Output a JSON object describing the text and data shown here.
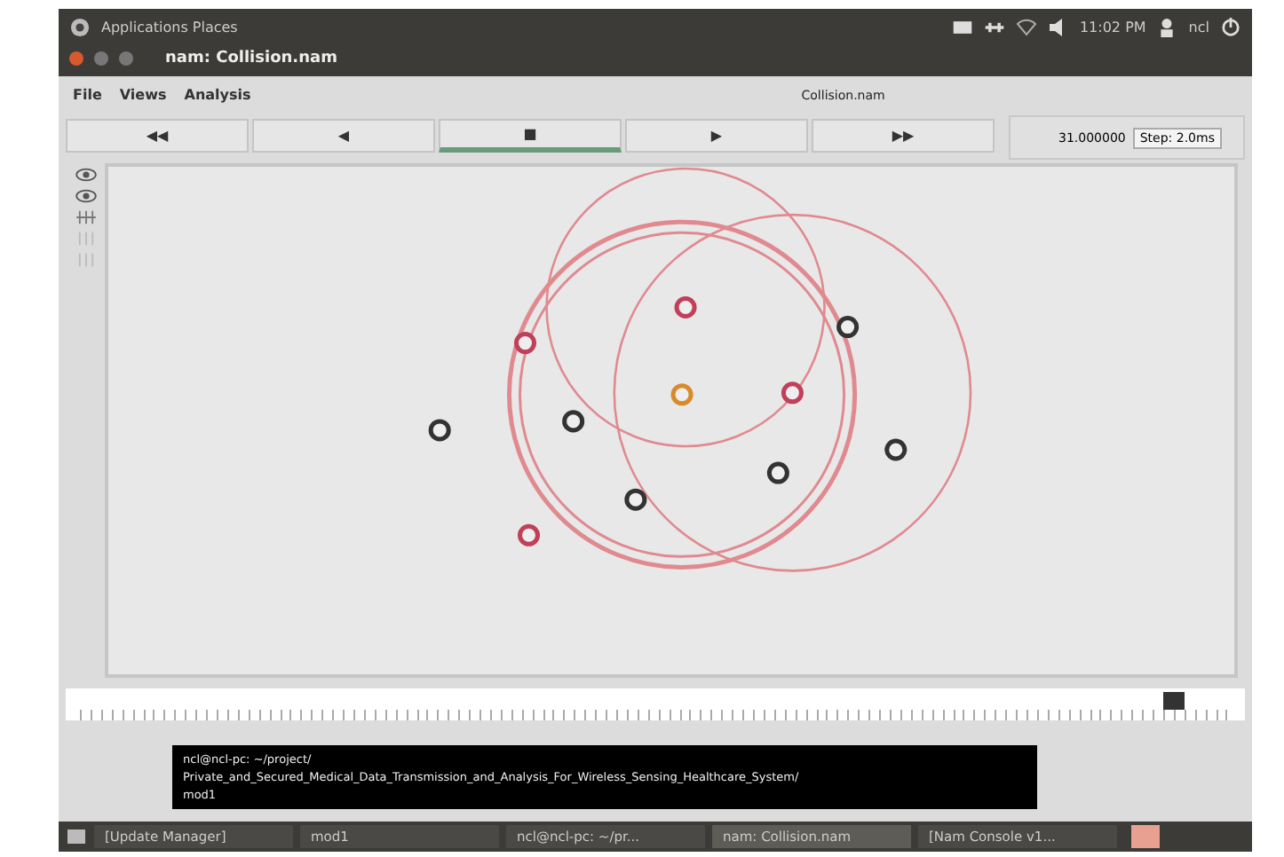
{
  "top_panel": {
    "menu": "Applications  Places",
    "clock": "11:02 PM",
    "user": "ncl"
  },
  "window": {
    "title": "nam: Collision.nam"
  },
  "menu": [
    "File",
    "Views",
    "Analysis"
  ],
  "file_label": "Collision.nam",
  "controls": [
    {
      "label": "◀◀",
      "selected": false
    },
    {
      "label": "◀",
      "selected": false
    },
    {
      "label": "■",
      "selected": true
    },
    {
      "label": "▶",
      "selected": false
    },
    {
      "label": "▶▶",
      "selected": false
    }
  ],
  "time": "31.000000",
  "step": "Step: 2.0ms",
  "nodes": [
    {
      "color": "#c0405a"
    },
    {
      "color": "#c0405a"
    },
    {
      "color": "#d98a2b"
    },
    {
      "color": "#c0405a"
    },
    {
      "color": "#333333"
    },
    {
      "color": "#333333"
    },
    {
      "color": "#333333"
    },
    {
      "color": "#333333"
    },
    {
      "color": "#333333"
    },
    {
      "color": "#333333"
    },
    {
      "color": "#c0405a"
    }
  ],
  "timeline": {
    "level": 0.93
  },
  "terminal": [
    "ncl@ncl-pc: ~/project/",
    "Private_and_Secured_Medical_Data_Transmission_and_Analysis_For_Wireless_Sensing_Healthcare_System/",
    "mod1"
  ],
  "taskbar": [
    {
      "label": "[Update Manager]",
      "selected": false
    },
    {
      "label": "mod1",
      "selected": false
    },
    {
      "label": "ncl@ncl-pc: ~/pr...",
      "selected": false
    },
    {
      "label": "nam: Collision.nam",
      "selected": true
    },
    {
      "label": "[Nam Console v1...",
      "selected": false
    }
  ]
}
